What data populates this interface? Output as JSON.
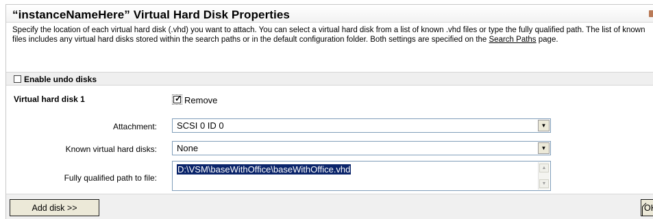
{
  "title": "“instanceNameHere” Virtual Hard Disk Properties",
  "description": {
    "before_link": "Specify the location of each virtual hard disk (.vhd) you want to attach. You can select a virtual hard disk from a list of known .vhd files or type the fully qualified path. The list of known files includes any virtual hard disks stored within the search paths or in the default configuration folder. Both settings are specified on the ",
    "link": "Search Paths",
    "after_link": " page."
  },
  "undo": {
    "label": "Enable undo disks",
    "checked": false
  },
  "disk": {
    "heading": "Virtual hard disk 1",
    "remove_label": "Remove",
    "remove_checked": true,
    "attachment_label": "Attachment:",
    "attachment_value": "SCSI 0 ID 0",
    "known_label": "Known virtual hard disks:",
    "known_value": "None",
    "path_label": "Fully qualified path to file:",
    "path_value": "D:\\VSM\\baseWithOffice\\baseWithOffice.vhd"
  },
  "buttons": {
    "add_disk": "Add disk >>",
    "ok": "OK"
  },
  "colors": {
    "selection": "#0a246a",
    "input_border": "#7f9db9",
    "button_face": "#ece9d8"
  }
}
